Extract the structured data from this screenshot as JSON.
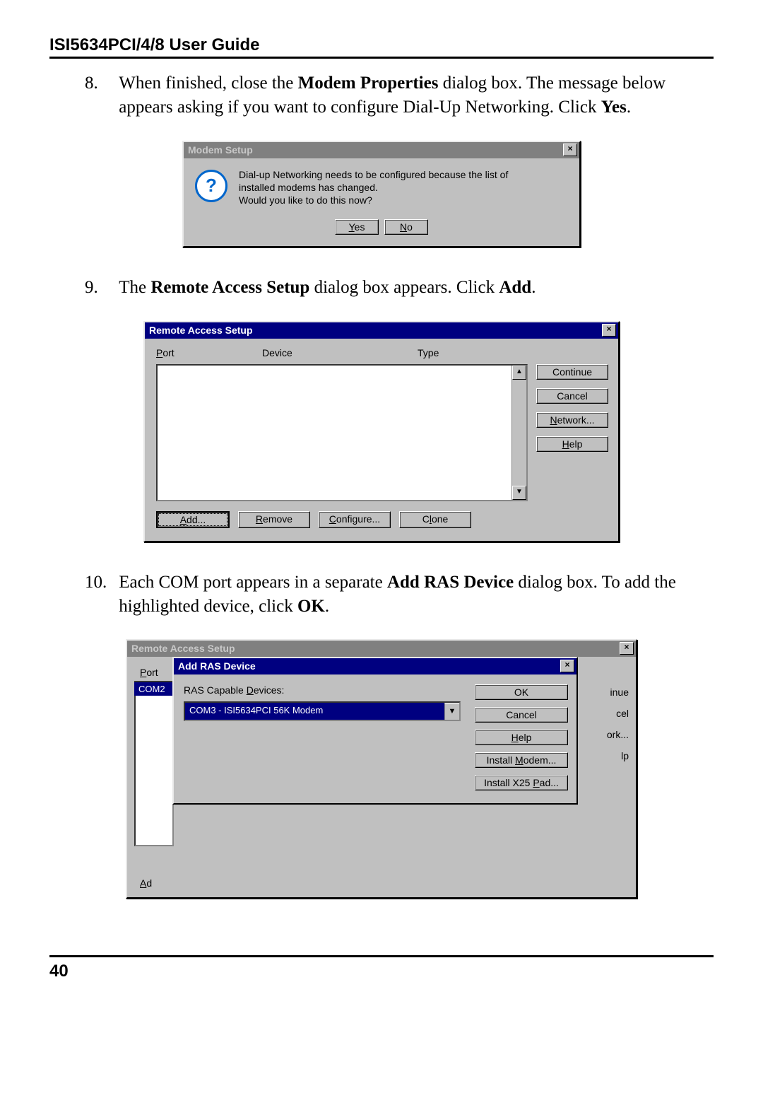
{
  "header": "ISI5634PCI/4/8 User Guide",
  "page_number": "40",
  "steps": {
    "s8": {
      "num": "8.",
      "pre": "When finished, close the ",
      "b1": "Modem Properties",
      "mid": " dialog box.  The message below appears asking if you want to configure Dial-Up Networking. Click ",
      "b2": "Yes",
      "post": "."
    },
    "s9": {
      "num": "9.",
      "pre": "The ",
      "b1": "Remote Access Setup",
      "mid": " dialog box appears.  Click ",
      "b2": "Add",
      "post": "."
    },
    "s10": {
      "num": "10.",
      "pre": "Each COM port appears in a separate ",
      "b1": "Add RAS Device",
      "mid": " dialog box. To add the highlighted device, click ",
      "b2": "OK",
      "post": "."
    }
  },
  "modem_dialog": {
    "title": "Modem Setup",
    "message_l1": "Dial-up Networking needs to be configured because the list of",
    "message_l2": "installed modems has changed.",
    "message_l3": "Would you like to do this now?",
    "yes": "Yes",
    "no": "No"
  },
  "ras_dialog": {
    "title": "Remote Access Setup",
    "col_port": "Port",
    "col_device": "Device",
    "col_type": "Type",
    "btn_continue": "Continue",
    "btn_cancel": "Cancel",
    "btn_network": "Network...",
    "btn_help": "Help",
    "btn_add": "Add...",
    "btn_remove": "Remove",
    "btn_configure": "Configure...",
    "btn_clone": "Clone"
  },
  "ras3": {
    "title_outer": "Remote Access Setup",
    "port_label": "Port",
    "com_row": "COM2",
    "side_inue": "inue",
    "side_cel": "cel",
    "side_ork": "ork...",
    "side_lp": "lp",
    "ad": "Ad",
    "add_title": "Add RAS Device",
    "devices_label": "RAS Capable Devices:",
    "selected_device": "COM3 - ISI5634PCI  56K Modem",
    "btn_ok": "OK",
    "btn_cancel": "Cancel",
    "btn_help": "Help",
    "btn_install_modem": "Install Modem...",
    "btn_install_x25": "Install X25 Pad..."
  }
}
